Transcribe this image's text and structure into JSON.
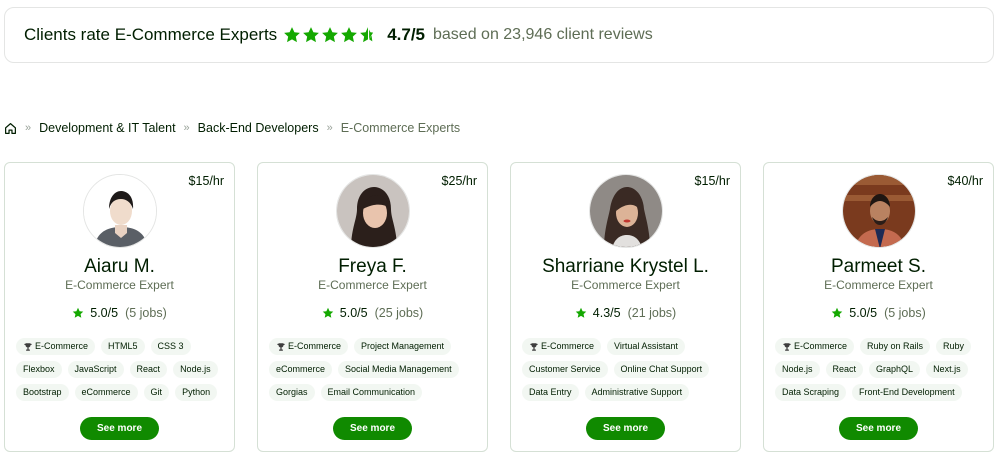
{
  "banner": {
    "title": "Clients rate E-Commerce Experts",
    "score": "4.7/5",
    "based": "based on 23,946 client reviews",
    "star_color": "#14a800"
  },
  "breadcrumb": {
    "items": [
      "Development & IT Talent",
      "Back-End Developers"
    ],
    "current": "E-Commerce Experts",
    "separator": "»"
  },
  "cards": [
    {
      "name": "Aiaru M.",
      "title": "E-Commerce Expert",
      "rate": "$15/hr",
      "score": "5.0/5",
      "jobs": "(5 jobs)",
      "skills": [
        "E-Commerce",
        "HTML5",
        "CSS 3",
        "Flexbox",
        "JavaScript",
        "React",
        "Node.js",
        "Bootstrap",
        "eCommerce",
        "Git",
        "Python"
      ],
      "button": "See more"
    },
    {
      "name": "Freya F.",
      "title": "E-Commerce Expert",
      "rate": "$25/hr",
      "score": "5.0/5",
      "jobs": "(25 jobs)",
      "skills": [
        "E-Commerce",
        "Project Management",
        "eCommerce",
        "Social Media Management",
        "Gorgias",
        "Email Communication"
      ],
      "button": "See more"
    },
    {
      "name": "Sharriane Krystel L.",
      "title": "E-Commerce Expert",
      "rate": "$15/hr",
      "score": "4.3/5",
      "jobs": "(21 jobs)",
      "skills": [
        "E-Commerce",
        "Virtual Assistant",
        "Customer Service",
        "Online Chat Support",
        "Data Entry",
        "Administrative Support"
      ],
      "button": "See more"
    },
    {
      "name": "Parmeet S.",
      "title": "E-Commerce Expert",
      "rate": "$40/hr",
      "score": "5.0/5",
      "jobs": "(5 jobs)",
      "skills": [
        "E-Commerce",
        "Ruby on Rails",
        "Ruby",
        "Node.js",
        "React",
        "GraphQL",
        "Next.js",
        "Data Scraping",
        "Front-End Development"
      ],
      "button": "See more"
    }
  ]
}
